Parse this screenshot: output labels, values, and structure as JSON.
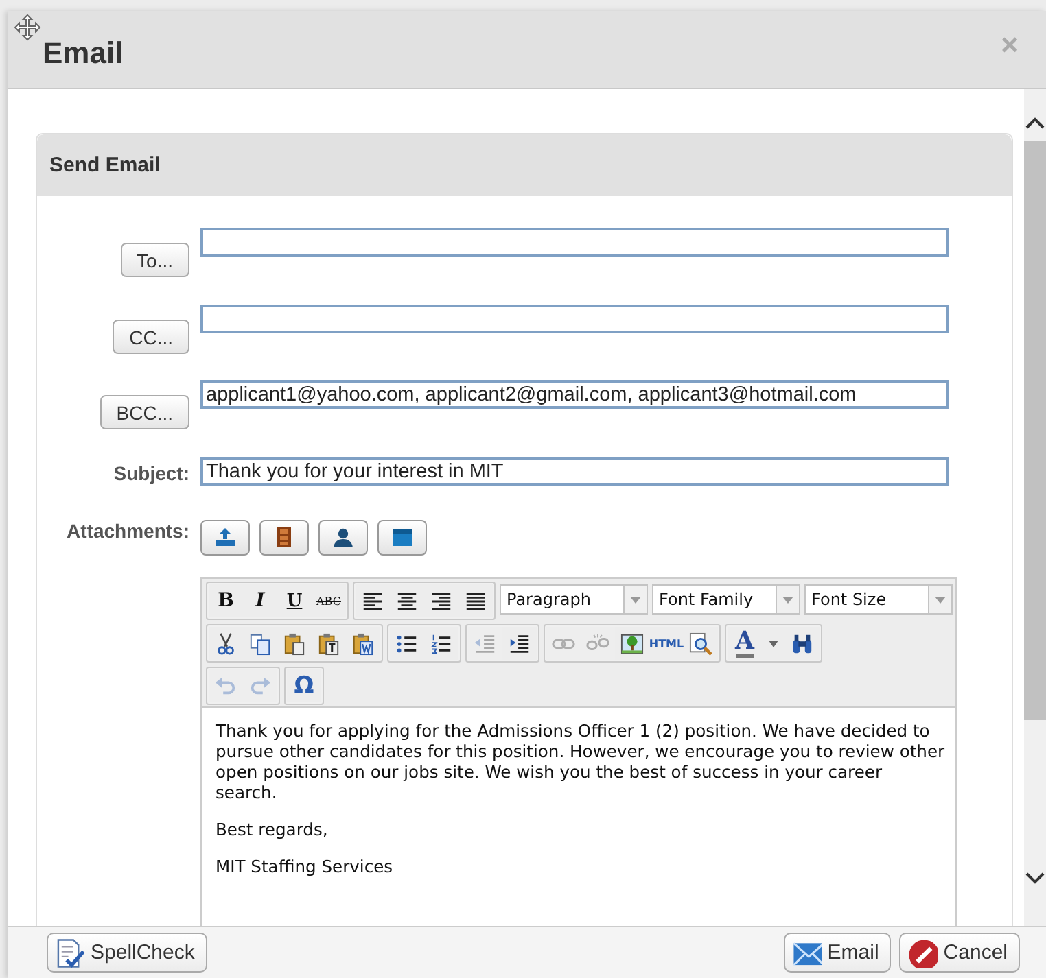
{
  "dialog": {
    "title": "Email",
    "close_glyph": "×"
  },
  "panel": {
    "title": "Send Email"
  },
  "recipients": [
    {
      "button": "To..."
    },
    {
      "button": "CC..."
    },
    {
      "button": "BCC...",
      "value": "applicant1@yahoo.com, applicant2@gmail.com, applicant3@hotmail.com"
    }
  ],
  "subject": {
    "label": "Subject:",
    "value": "Thank you for your interest in MIT"
  },
  "attachments": {
    "label": "Attachments:",
    "buttons": [
      {
        "kind": "upload"
      },
      {
        "kind": "cabinet"
      },
      {
        "kind": "person"
      },
      {
        "kind": "folder"
      }
    ]
  },
  "editor": {
    "toolbar": [
      [
        [
          {
            "kind": "bold",
            "glyph": "B",
            "disabled": false
          },
          {
            "kind": "italic",
            "glyph": "I",
            "disabled": false
          },
          {
            "kind": "underline",
            "glyph": "U",
            "disabled": false
          },
          {
            "kind": "strike",
            "glyph": "ABC",
            "disabled": false
          }
        ],
        [
          {
            "kind": "align-left",
            "disabled": false
          },
          {
            "kind": "align-center",
            "disabled": false
          },
          {
            "kind": "align-right",
            "disabled": false
          },
          {
            "kind": "justify",
            "disabled": false
          }
        ],
        [
          {
            "kind": "select",
            "label": "Paragraph"
          }
        ],
        [
          {
            "kind": "select",
            "label": "Font Family"
          }
        ],
        [
          {
            "kind": "select",
            "label": "Font Size"
          }
        ]
      ],
      [
        [
          {
            "kind": "cut",
            "disabled": false
          },
          {
            "kind": "copy",
            "disabled": false
          },
          {
            "kind": "paste",
            "disabled": false
          },
          {
            "kind": "paste-text",
            "disabled": false
          },
          {
            "kind": "paste-word",
            "disabled": false
          }
        ],
        [
          {
            "kind": "bullets",
            "disabled": false
          },
          {
            "kind": "numbers",
            "disabled": false
          }
        ],
        [
          {
            "kind": "outdent",
            "disabled": true
          },
          {
            "kind": "indent",
            "disabled": false
          }
        ],
        [
          {
            "kind": "link",
            "disabled": true
          },
          {
            "kind": "unlink",
            "disabled": true
          },
          {
            "kind": "image",
            "disabled": false
          },
          {
            "kind": "html",
            "glyph": "HTML",
            "disabled": false
          },
          {
            "kind": "preview",
            "disabled": false
          }
        ],
        [
          {
            "kind": "text-color",
            "glyph": "A",
            "disabled": false
          },
          {
            "kind": "color-menu",
            "disabled": false
          },
          {
            "kind": "find",
            "disabled": false
          }
        ]
      ],
      [
        [
          {
            "kind": "undo",
            "disabled": true
          },
          {
            "kind": "redo",
            "disabled": true
          }
        ],
        [
          {
            "kind": "special",
            "glyph": "Ω",
            "disabled": false
          }
        ]
      ]
    ],
    "body": [
      "Thank you for applying for the Admissions Officer 1 (2) position. We have decided to pursue other candidates for this position. However, we encourage you to review other open positions on our jobs site. We wish you the best of success in your career search.",
      "Best regards,",
      "MIT Staffing Services"
    ]
  },
  "footer": {
    "buttons": [
      {
        "kind": "spellcheck",
        "label": "SpellCheck"
      },
      {
        "kind": "email",
        "label": "Email"
      },
      {
        "kind": "cancel",
        "label": "Cancel"
      }
    ]
  }
}
